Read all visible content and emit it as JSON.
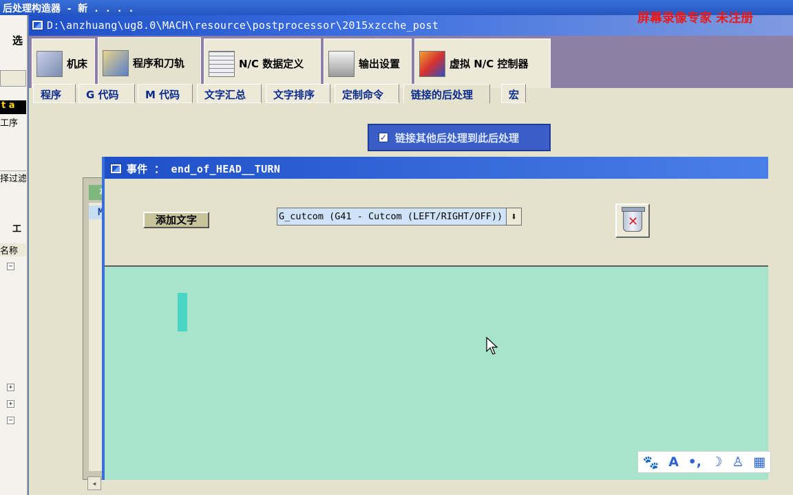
{
  "background_app": {
    "title": "后处理构造器 - 新 . . . .",
    "left_items": [
      "选",
      "t  a",
      "工序",
      "择过滤",
      "工",
      "名称"
    ]
  },
  "window": {
    "title": "D:\\anzhuang\\ug8.0\\MACH\\resource\\postprocessor\\2015xzcche_post"
  },
  "watermark": "屏幕录像专家 未注册",
  "main_tabs": [
    {
      "label": "机床",
      "icon": "machine-icon"
    },
    {
      "label": "程序和刀轨",
      "icon": "toolpath-icon"
    },
    {
      "label": "N/C 数据定义",
      "icon": "nc-data-icon"
    },
    {
      "label": "输出设置",
      "icon": "printer-icon"
    },
    {
      "label": "虚拟 N/C 控制器",
      "icon": "controller-icon"
    }
  ],
  "sub_tabs": [
    "程序",
    "G 代码",
    "M 代码",
    "文字汇总",
    "文字排序",
    "定制命令",
    "链接的后处理",
    "宏"
  ],
  "link_checkbox_label": "链接其他后处理到此后处理",
  "head_panel": {
    "header": "机头",
    "items": [
      "MILL"
    ]
  },
  "event_dialog": {
    "title": "事件 ： end_of_HEAD__TURN",
    "add_text_label": "添加文字",
    "combo_value": "G_cutcom (G41 - Cutcom (LEFT/RIGHT/OFF))",
    "combo_arrow": "⬇"
  },
  "ime_toolbar": [
    "🐾",
    "A",
    "•,",
    "☽",
    "♙",
    "▦"
  ]
}
